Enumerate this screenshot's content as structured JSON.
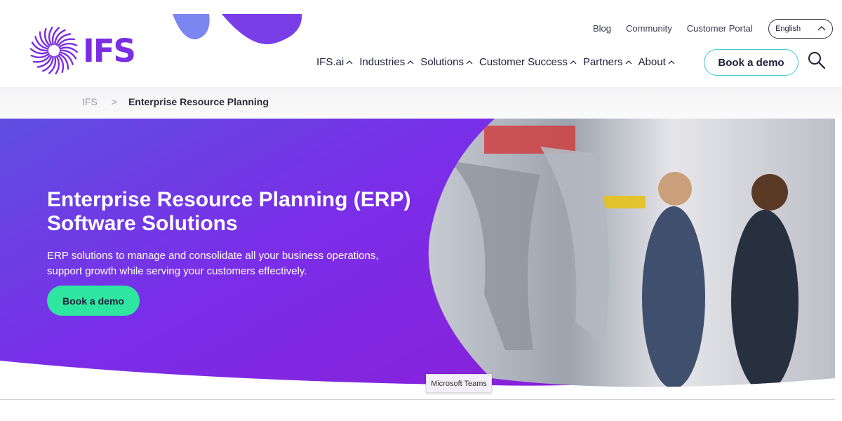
{
  "brand": {
    "name": "IFS",
    "color": "#7a2ee0"
  },
  "utility_nav": [
    "Blog",
    "Community",
    "Customer Portal"
  ],
  "language": {
    "selected": "English"
  },
  "main_nav": [
    "IFS.ai",
    "Industries",
    "Solutions",
    "Customer Success",
    "Partners",
    "About"
  ],
  "header_cta": "Book a demo",
  "search": {
    "icon": "search-icon"
  },
  "breadcrumb": {
    "home": "IFS",
    "separator": ">",
    "current": "Enterprise Resource Planning"
  },
  "hero": {
    "title_line1": "Enterprise Resource Planning (ERP)",
    "title_line2": "Software Solutions",
    "subtitle_line1": "ERP solutions to manage and consolidate all your business operations,",
    "subtitle_line2": "support growth while serving your customers effectively.",
    "cta": "Book a demo",
    "accent": "#7a2ee0",
    "cta_color": "#2ee6a0"
  },
  "tooltip": "Microsoft Teams"
}
